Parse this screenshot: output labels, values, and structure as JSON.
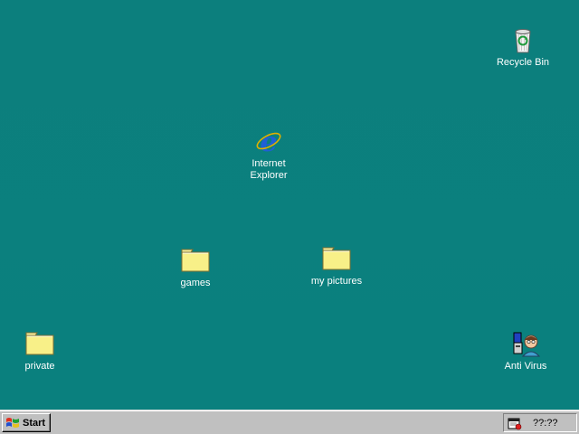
{
  "desktop": {
    "background_color": "#0b8080",
    "icons": [
      {
        "id": "recycle-bin",
        "label": "Recycle Bin",
        "icon": "recycle-bin-icon"
      },
      {
        "id": "internet-explorer",
        "label": "Internet\nExplorer",
        "icon": "internet-explorer-icon"
      },
      {
        "id": "games",
        "label": "games",
        "icon": "folder-icon"
      },
      {
        "id": "my-pictures",
        "label": "my pictures",
        "icon": "folder-icon"
      },
      {
        "id": "private",
        "label": "private",
        "icon": "folder-icon"
      },
      {
        "id": "anti-virus",
        "label": "Anti Virus",
        "icon": "anti-virus-icon"
      }
    ]
  },
  "taskbar": {
    "start_label": "Start",
    "start_icon": "windows-logo-icon",
    "tray_icon": "scheduler-icon",
    "clock": "??:??"
  }
}
